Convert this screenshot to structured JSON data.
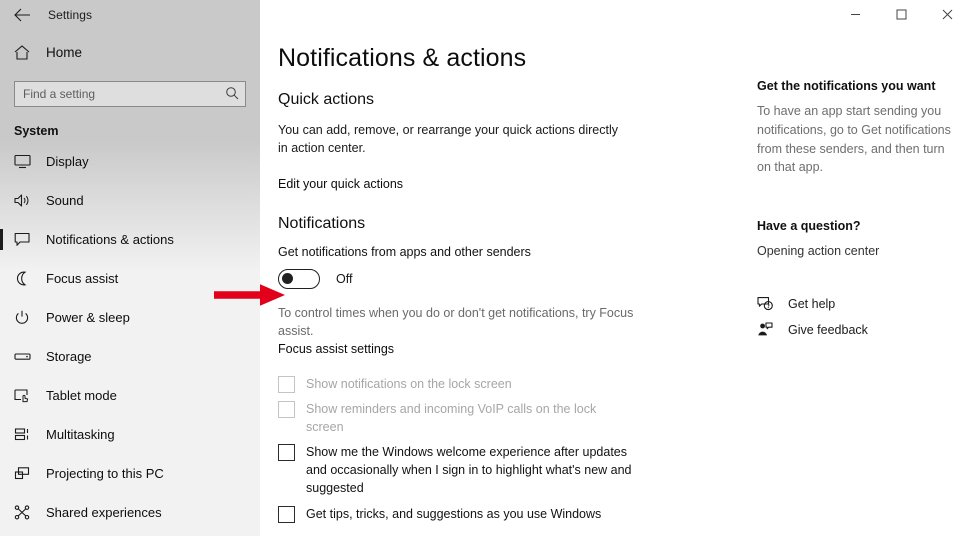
{
  "window": {
    "app_title": "Settings",
    "back_icon": "back-arrow-icon",
    "controls": {
      "minimize": "minimize-icon",
      "maximize": "maximize-icon",
      "close": "close-icon"
    }
  },
  "sidebar": {
    "home_label": "Home",
    "home_icon": "home-icon",
    "search": {
      "placeholder": "Find a setting",
      "value": "",
      "icon": "search-icon"
    },
    "group_title": "System",
    "items": [
      {
        "label": "Display",
        "icon": "display-icon",
        "active": false
      },
      {
        "label": "Sound",
        "icon": "sound-icon",
        "active": false
      },
      {
        "label": "Notifications & actions",
        "icon": "notifications-icon",
        "active": true
      },
      {
        "label": "Focus assist",
        "icon": "moon-icon",
        "active": false
      },
      {
        "label": "Power & sleep",
        "icon": "power-icon",
        "active": false
      },
      {
        "label": "Storage",
        "icon": "storage-icon",
        "active": false
      },
      {
        "label": "Tablet mode",
        "icon": "tablet-icon",
        "active": false
      },
      {
        "label": "Multitasking",
        "icon": "multitasking-icon",
        "active": false
      },
      {
        "label": "Projecting to this PC",
        "icon": "projecting-icon",
        "active": false
      },
      {
        "label": "Shared experiences",
        "icon": "shared-experiences-icon",
        "active": false
      }
    ]
  },
  "main": {
    "page_title": "Notifications & actions",
    "quick_actions": {
      "heading": "Quick actions",
      "description": "You can add, remove, or rearrange your quick actions directly in action center.",
      "link": "Edit your quick actions"
    },
    "notifications": {
      "heading": "Notifications",
      "toggle_label": "Get notifications from apps and other senders",
      "toggle_state": "Off",
      "toggle_on": false,
      "hint": "To control times when you do or don't get notifications, try Focus assist.",
      "focus_link": "Focus assist settings",
      "checkboxes": [
        {
          "label": "Show notifications on the lock screen",
          "checked": false,
          "disabled": true
        },
        {
          "label": "Show reminders and incoming VoIP calls on the lock screen",
          "checked": false,
          "disabled": true
        },
        {
          "label": "Show me the Windows welcome experience after updates and occasionally when I sign in to highlight what's new and suggested",
          "checked": false,
          "disabled": false
        },
        {
          "label": "Get tips, tricks, and suggestions as you use Windows",
          "checked": false,
          "disabled": false
        }
      ]
    }
  },
  "help_pane": {
    "heading1": "Get the notifications you want",
    "text1": "To have an app start sending you notifications, go to Get notifications from these senders, and then turn on that app.",
    "heading2": "Have a question?",
    "link1": "Opening action center",
    "actions": [
      {
        "label": "Get help",
        "icon": "get-help-icon"
      },
      {
        "label": "Give feedback",
        "icon": "give-feedback-icon"
      }
    ]
  },
  "annotation": {
    "arrow_color": "#E3001B",
    "arrow_icon": "red-arrow-pointer"
  }
}
